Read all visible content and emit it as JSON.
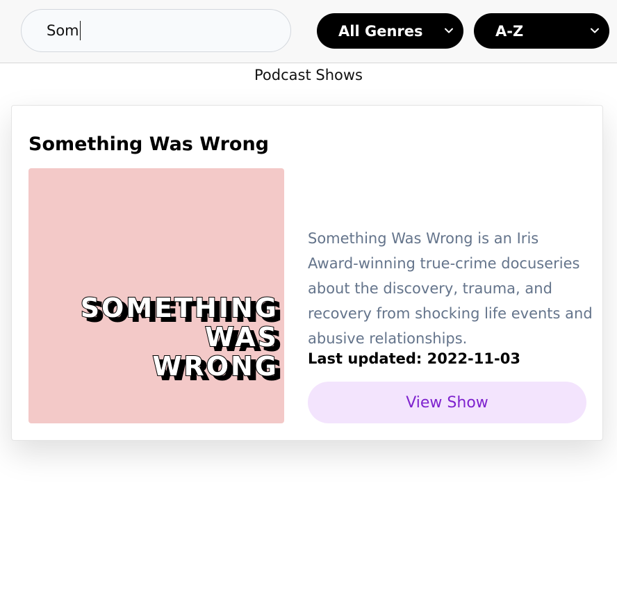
{
  "search": {
    "value": "Som"
  },
  "filters": {
    "genre": {
      "selected": "All Genres"
    },
    "sort": {
      "selected": "A-Z"
    }
  },
  "page": {
    "section_title": "Podcast Shows"
  },
  "show": {
    "title": "Something Was Wrong",
    "cover_text": [
      "SOMETHING",
      "WAS",
      "WRONG"
    ],
    "description": "Something Was Wrong is an Iris Award-winning true-crime docuseries about the discovery, trauma, and recovery from shocking life events and abusive relationships.",
    "last_updated": "Last updated: 2022-11-03",
    "button_label": "View Show"
  },
  "colors": {
    "accent_text": "#7e22ce",
    "button_bg": "#f3e4fd",
    "cover_bg": "#f3c9c8",
    "select_bg": "#000000"
  }
}
